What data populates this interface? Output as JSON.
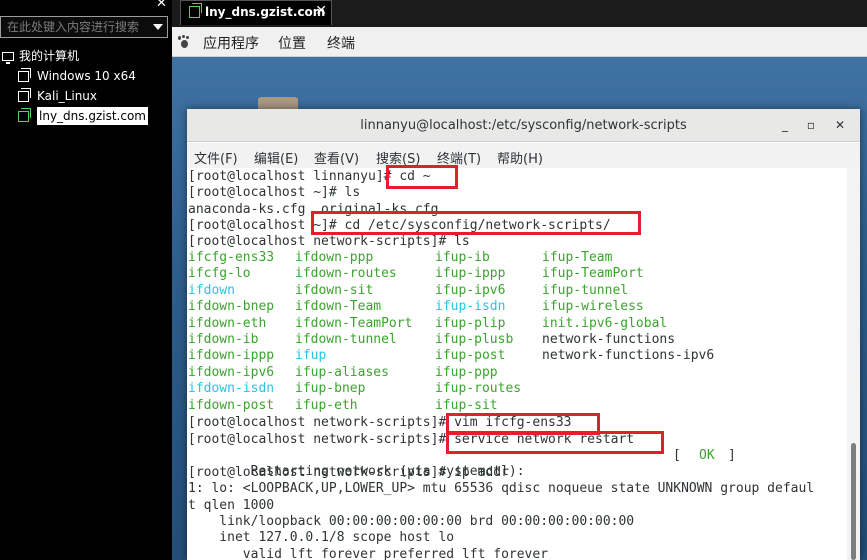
{
  "library": {
    "close_glyph": "✕",
    "search_placeholder": "在此处键入内容进行搜索",
    "root_label": "我的计算机",
    "vms": [
      {
        "label": "Windows 10 x64",
        "running": false,
        "selected": false
      },
      {
        "label": "Kali_Linux",
        "running": false,
        "selected": false
      },
      {
        "label": "lny_dns.gzist.com",
        "running": true,
        "selected": true
      }
    ]
  },
  "tabs": [
    {
      "title": "lny_dns.gzist.com",
      "close_glyph": "✕"
    }
  ],
  "gnome_bar": {
    "items": [
      "应用程序",
      "位置",
      "终端"
    ]
  },
  "terminal": {
    "title": "linnanyu@localhost:/etc/sysconfig/network-scripts",
    "buttons": {
      "minimize": "_",
      "maximize": "▫",
      "close": "✕"
    },
    "menu": [
      "文件(F)",
      "编辑(E)",
      "查看(V)",
      "搜索(S)",
      "终端(T)",
      "帮助(H)"
    ],
    "prompt_home": "[root@localhost linnanyu]# ",
    "prompt_tilde": "[root@localhost ~]# ",
    "prompt_ns": "[root@localhost network-scripts]# ",
    "cmd_cd_home": "cd ~",
    "cmd_ls": "ls",
    "home_ls_output": "anaconda-ks.cfg  original-ks.cfg",
    "cmd_cd_ns": "cd /etc/sysconfig/network-scripts/",
    "ls_rows": [
      [
        "ifcfg-ens33",
        "ifdown-ppp",
        "ifup-ib",
        "ifup-Team"
      ],
      [
        "ifcfg-lo",
        "ifdown-routes",
        "ifup-ippp",
        "ifup-TeamPort"
      ],
      [
        "ifdown",
        "ifdown-sit",
        "ifup-ipv6",
        "ifup-tunnel"
      ],
      [
        "ifdown-bnep",
        "ifdown-Team",
        "ifup-isdn",
        "ifup-wireless"
      ],
      [
        "ifdown-eth",
        "ifdown-TeamPort",
        "ifup-plip",
        "init.ipv6-global"
      ],
      [
        "ifdown-ib",
        "ifdown-tunnel",
        "ifup-plusb",
        "network-functions"
      ],
      [
        "ifdown-ippp",
        "ifup",
        "ifup-post",
        "network-functions-ipv6"
      ],
      [
        "ifdown-ipv6",
        "ifup-aliases",
        "ifup-ppp",
        ""
      ],
      [
        "ifdown-isdn",
        "ifup-bnep",
        "ifup-routes",
        ""
      ],
      [
        "ifdown-post",
        "ifup-eth",
        "ifup-sit",
        ""
      ]
    ],
    "ls_colors": [
      [
        "g",
        "g",
        "g",
        "g"
      ],
      [
        "g",
        "g",
        "g",
        "g"
      ],
      [
        "c",
        "g",
        "g",
        "g"
      ],
      [
        "g",
        "g",
        "c",
        "g"
      ],
      [
        "g",
        "g",
        "g",
        "g"
      ],
      [
        "g",
        "g",
        "g",
        "n"
      ],
      [
        "g",
        "c",
        "g",
        "n"
      ],
      [
        "g",
        "g",
        "g",
        ""
      ],
      [
        "c",
        "g",
        "g",
        ""
      ],
      [
        "g",
        "g",
        "g",
        ""
      ]
    ],
    "cmd_vim": "vim ifcfg-ens33",
    "cmd_restart": "service network restart",
    "restart_output": "Restarting network (via systemctl):",
    "restart_status_open": "[",
    "restart_status": "OK",
    "restart_status_close": "]",
    "cmd_ipaddr": "ip addr",
    "ipaddr_output": [
      "1: lo: <LOOPBACK,UP,LOWER_UP> mtu 65536 qdisc noqueue state UNKNOWN group defaul",
      "t qlen 1000",
      "    link/loopback 00:00:00:00:00:00 brd 00:00:00:00:00:00",
      "    inet 127.0.0.1/8 scope host lo",
      "       valid_lft forever preferred_lft forever"
    ]
  },
  "colors": {
    "annotation_red": "#e0202a",
    "ls_executable_green": "#3aa52c",
    "ls_symlink_cyan": "#29c3e6"
  }
}
